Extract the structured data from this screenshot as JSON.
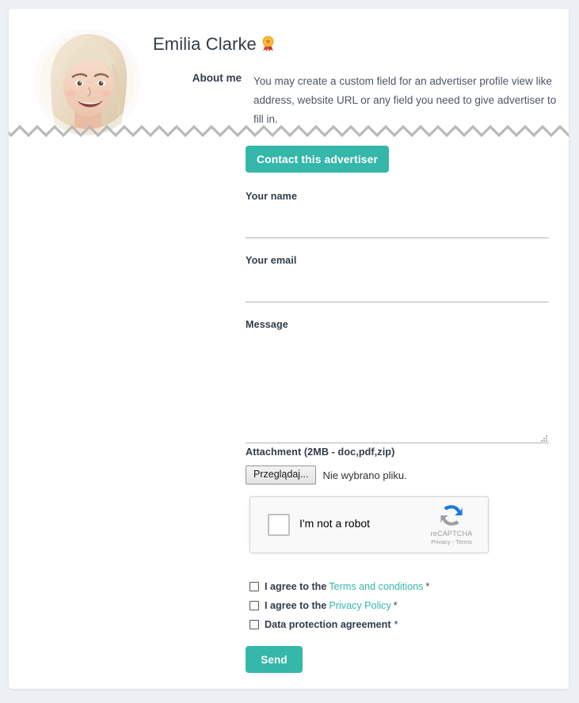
{
  "theme": {
    "accent": "#35b7aa",
    "page_bg": "#edf1f5",
    "card_bg": "#ffffff",
    "text": "#2f3d4a"
  },
  "profile": {
    "name": "Emilia Clarke",
    "badge_icon": "award-rosette-icon",
    "avatar_alt": "avatar",
    "about_label": "About me",
    "about_text": "You may create a custom field for an advertiser profile view like address, website URL or any field you need to give advertiser to fill in."
  },
  "form": {
    "contact_button": "Contact this advertiser",
    "fields": [
      {
        "label": "Your name",
        "value": "",
        "placeholder": ""
      },
      {
        "label": "Your email",
        "value": "",
        "placeholder": ""
      },
      {
        "label": "Message",
        "value": "",
        "placeholder": ""
      }
    ],
    "attachment": {
      "label": "Attachment (2MB - doc,pdf,zip)",
      "browse_button": "Przeglądaj...",
      "file_status": "Nie wybrano pliku."
    },
    "recaptcha": {
      "checkbox_label": "I'm not a robot",
      "brand": "reCAPTCHA",
      "links": "Privacy - Terms",
      "checked": false
    },
    "consents": [
      {
        "prefix": "I agree to the",
        "link": "Terms and conditions",
        "suffix": "*",
        "checked": false
      },
      {
        "prefix": "I agree to the",
        "link": "Privacy Policy",
        "suffix": "*",
        "checked": false
      },
      {
        "prefix": "Data protection agreement",
        "link": "",
        "suffix": "*",
        "checked": false
      }
    ],
    "send_button": "Send"
  }
}
